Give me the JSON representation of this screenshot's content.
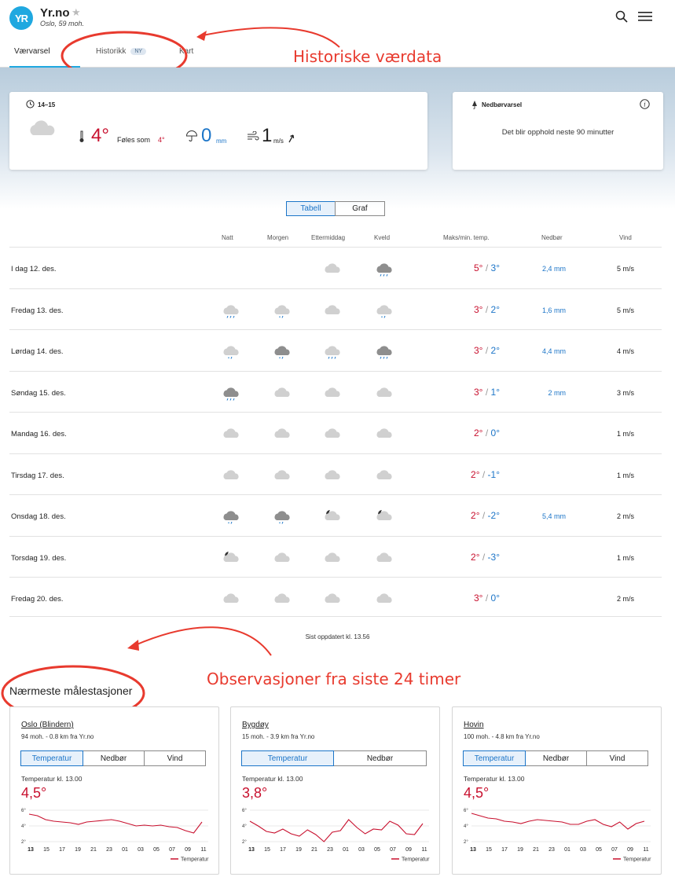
{
  "header": {
    "logo": "YR",
    "title": "Yr.no",
    "subtitle": "Oslo, 59 moh."
  },
  "tabs": [
    {
      "label": "Værvarsel",
      "active": true
    },
    {
      "label": "Historikk",
      "badge": "NY"
    },
    {
      "label": "Kart"
    }
  ],
  "now": {
    "time": "14–15",
    "temp": "4°",
    "feels_label": "Føles som",
    "feels_value": "4°",
    "precip_value": "0",
    "precip_unit": "mm",
    "wind_value": "1",
    "wind_unit": "m/s"
  },
  "nedbor": {
    "title": "Nedbørvarsel",
    "message": "Det blir opphold neste 90 minutter"
  },
  "view_toggle": {
    "table": "Tabell",
    "graph": "Graf"
  },
  "table": {
    "headers": {
      "night": "Natt",
      "morning": "Morgen",
      "afternoon": "Ettermiddag",
      "evening": "Kveld",
      "temp": "Maks/min. temp.",
      "precip": "Nedbør",
      "wind": "Vind"
    },
    "rows": [
      {
        "day": "I dag 12. des.",
        "max": "5°",
        "min": "3°",
        "precip": "2,4 mm",
        "wind": "5 m/s",
        "icons": [
          "",
          "",
          "cloud",
          "rain-dark"
        ]
      },
      {
        "day": "Fredag 13. des.",
        "max": "3°",
        "min": "2°",
        "precip": "1,6 mm",
        "wind": "5 m/s",
        "icons": [
          "rain",
          "sleet",
          "cloud",
          "sleet"
        ]
      },
      {
        "day": "Lørdag 14. des.",
        "max": "3°",
        "min": "2°",
        "precip": "4,4 mm",
        "wind": "4 m/s",
        "icons": [
          "sleet",
          "sleet-dark",
          "rain",
          "rain-dark"
        ]
      },
      {
        "day": "Søndag 15. des.",
        "max": "3°",
        "min": "1°",
        "precip": "2 mm",
        "wind": "3 m/s",
        "icons": [
          "rain-dark",
          "cloud",
          "cloud",
          "cloud"
        ]
      },
      {
        "day": "Mandag 16. des.",
        "max": "2°",
        "min": "0°",
        "precip": "",
        "wind": "1 m/s",
        "icons": [
          "cloud",
          "cloud",
          "cloud",
          "cloud"
        ]
      },
      {
        "day": "Tirsdag 17. des.",
        "max": "2°",
        "min": "-1°",
        "precip": "",
        "wind": "1 m/s",
        "icons": [
          "cloud",
          "cloud",
          "cloud",
          "cloud"
        ]
      },
      {
        "day": "Onsdag 18. des.",
        "max": "2°",
        "min": "-2°",
        "precip": "5,4 mm",
        "wind": "2 m/s",
        "icons": [
          "sleet-dark",
          "sleet-dark",
          "moon-cloud",
          "moon-cloud"
        ]
      },
      {
        "day": "Torsdag 19. des.",
        "max": "2°",
        "min": "-3°",
        "precip": "",
        "wind": "1 m/s",
        "icons": [
          "moon-cloud",
          "cloud",
          "cloud",
          "cloud"
        ]
      },
      {
        "day": "Fredag 20. des.",
        "max": "3°",
        "min": "0°",
        "precip": "",
        "wind": "2 m/s",
        "icons": [
          "cloud",
          "cloud",
          "cloud",
          "cloud"
        ]
      }
    ]
  },
  "updated": "Sist oppdatert kl. 13.56",
  "annotations": {
    "history": "Historiske værdata",
    "observations": "Observasjoner fra siste 24 timer"
  },
  "stations_title": "Nærmeste målestasjoner",
  "chart_common": {
    "ticks_y": [
      "6°",
      "4°",
      "2°"
    ],
    "ticks_x": [
      "13",
      "15",
      "17",
      "19",
      "21",
      "23",
      "01",
      "03",
      "05",
      "07",
      "09",
      "11"
    ],
    "legend": "Temperatur",
    "label": "Temperatur kl. 13.00"
  },
  "stations": [
    {
      "name": "Oslo (Blindern)",
      "distance": "94 moh. - 0.8 km fra Yr.no",
      "tabs": [
        "Temperatur",
        "Nedbør",
        "Vind"
      ],
      "value": "4,5°"
    },
    {
      "name": "Bygdøy",
      "distance": "15 moh. - 3.9 km fra Yr.no",
      "tabs": [
        "Temperatur",
        "Nedbør"
      ],
      "value": "3,8°"
    },
    {
      "name": "Hovin",
      "distance": "100 moh. - 4.8 km fra Yr.no",
      "tabs": [
        "Temperatur",
        "Nedbør",
        "Vind"
      ],
      "value": "4,5°"
    }
  ],
  "chart_data": [
    {
      "type": "line",
      "xlabel": "",
      "ylabel": "",
      "ylim": [
        2,
        6
      ],
      "series": [
        {
          "name": "Temperatur",
          "values": [
            5.5,
            5.3,
            4.8,
            4.6,
            4.5,
            4.4,
            4.2,
            4.5,
            4.6,
            4.7,
            4.8,
            4.6,
            4.3,
            4.0,
            4.1,
            4.0,
            4.1,
            3.9,
            3.8,
            3.4,
            3.1,
            4.5
          ]
        }
      ]
    },
    {
      "type": "line",
      "xlabel": "",
      "ylabel": "",
      "ylim": [
        2,
        6
      ],
      "series": [
        {
          "name": "Temperatur",
          "values": [
            4.6,
            4.0,
            3.3,
            3.1,
            3.6,
            3.0,
            2.7,
            3.5,
            2.9,
            2.0,
            3.2,
            3.4,
            4.8,
            3.8,
            3.0,
            3.6,
            3.5,
            4.6,
            4.1,
            3.0,
            2.9,
            4.3
          ]
        }
      ]
    },
    {
      "type": "line",
      "xlabel": "",
      "ylabel": "",
      "ylim": [
        2,
        6
      ],
      "series": [
        {
          "name": "Temperatur",
          "values": [
            5.6,
            5.3,
            5.0,
            4.9,
            4.6,
            4.5,
            4.3,
            4.6,
            4.8,
            4.7,
            4.6,
            4.5,
            4.2,
            4.2,
            4.6,
            4.8,
            4.2,
            3.9,
            4.5,
            3.6,
            4.3,
            4.6
          ]
        }
      ]
    }
  ]
}
